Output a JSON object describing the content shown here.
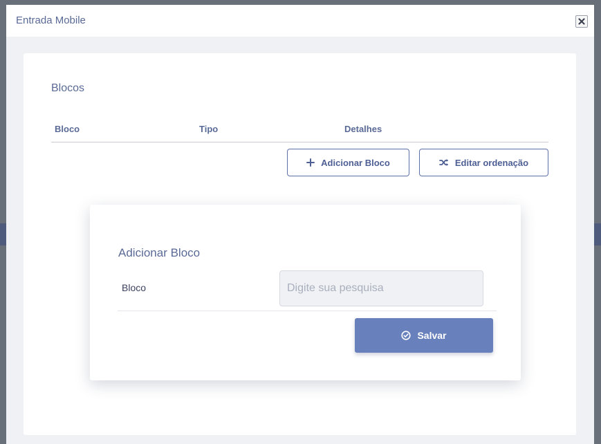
{
  "modal": {
    "title": "Entrada Mobile"
  },
  "blocks": {
    "title": "Blocos",
    "columns": [
      "Bloco",
      "Tipo",
      "Detalhes"
    ],
    "add_button": {
      "label": "Adicionar Bloco",
      "icon": "plus-icon"
    },
    "order_button": {
      "label": "Editar ordenação",
      "icon": "shuffle-icon"
    }
  },
  "add_block_form": {
    "title": "Adicionar Bloco",
    "field_label": "Bloco",
    "search_placeholder": "Digite sua pesquisa",
    "search_value": "",
    "save_button": {
      "label": "Salvar",
      "icon": "check-circle-icon"
    }
  },
  "colors": {
    "accent": "#6880bb",
    "text_primary": "#5a6a96",
    "border": "#5b6fa6"
  }
}
